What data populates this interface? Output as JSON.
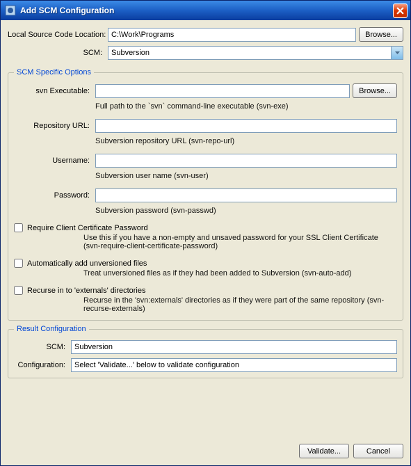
{
  "window": {
    "title": "Add SCM Configuration"
  },
  "top": {
    "location_label": "Local Source Code Location:",
    "location_value": "C:\\Work\\Programs",
    "browse_label": "Browse...",
    "scm_label": "SCM:",
    "scm_value": "Subversion"
  },
  "specific": {
    "legend": "SCM Specific Options",
    "svn_exe_label": "svn Executable:",
    "svn_exe_value": "",
    "svn_exe_browse": "Browse...",
    "svn_exe_hint": "Full path to the `svn` command-line executable (svn-exe)",
    "repo_label": "Repository URL:",
    "repo_value": "",
    "repo_hint": "Subversion repository URL (svn-repo-url)",
    "user_label": "Username:",
    "user_value": "",
    "user_hint": "Subversion user name (svn-user)",
    "pass_label": "Password:",
    "pass_value": "",
    "pass_hint": "Subversion password (svn-passwd)",
    "chk_cert_label": "Require Client Certificate Password",
    "chk_cert_hint": "Use this if you have a non-empty and unsaved password for your SSL Client Certificate (svn-require-client-certificate-password)",
    "chk_auto_label": "Automatically add unversioned files",
    "chk_auto_hint": "Treat unversioned files as if they had been added to Subversion (svn-auto-add)",
    "chk_recurse_label": "Recurse in to 'externals' directories",
    "chk_recurse_hint": "Recurse in the 'svn:externals' directories as if they were part of the same repository (svn-recurse-externals)"
  },
  "result": {
    "legend": "Result Configuration",
    "scm_label": "SCM:",
    "scm_value": "Subversion",
    "config_label": "Configuration:",
    "config_value": "Select 'Validate...' below to validate configuration"
  },
  "buttons": {
    "validate": "Validate...",
    "cancel": "Cancel"
  }
}
